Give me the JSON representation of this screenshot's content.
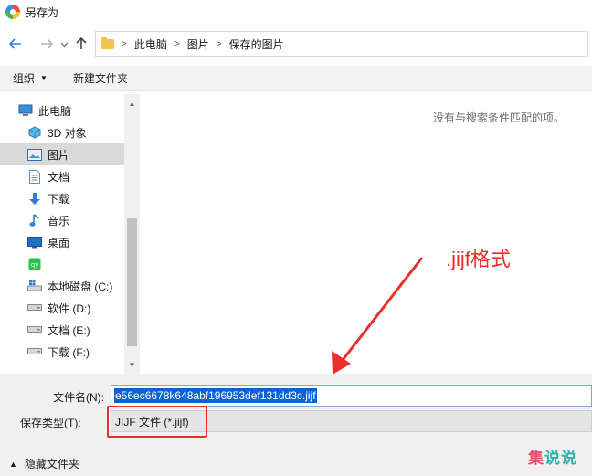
{
  "window": {
    "title": "另存为"
  },
  "nav": {
    "breadcrumbs": [
      "此电脑",
      "图片",
      "保存的图片"
    ]
  },
  "toolbar": {
    "organize_label": "组织",
    "new_folder_label": "新建文件夹"
  },
  "tree": {
    "items": [
      {
        "label": "此电脑",
        "icon": "computer-icon",
        "level": 0,
        "selected": false
      },
      {
        "label": "3D 对象",
        "icon": "3d-objects-icon",
        "level": 1,
        "selected": false
      },
      {
        "label": "图片",
        "icon": "pictures-icon",
        "level": 1,
        "selected": true
      },
      {
        "label": "文档",
        "icon": "documents-icon",
        "level": 1,
        "selected": false
      },
      {
        "label": "下载",
        "icon": "download-icon",
        "level": 1,
        "selected": false
      },
      {
        "label": "音乐",
        "icon": "music-icon",
        "level": 1,
        "selected": false
      },
      {
        "label": "桌面",
        "icon": "desktop-icon",
        "level": 1,
        "selected": false
      },
      {
        "label": "",
        "icon": "iqiyi-icon",
        "level": 1,
        "selected": false
      },
      {
        "label": "本地磁盘 (C:)",
        "icon": "windows-drive-icon",
        "level": 1,
        "selected": false
      },
      {
        "label": "软件 (D:)",
        "icon": "drive-icon",
        "level": 1,
        "selected": false
      },
      {
        "label": "文档 (E:)",
        "icon": "drive-icon",
        "level": 1,
        "selected": false
      },
      {
        "label": "下载 (F:)",
        "icon": "drive-icon",
        "level": 1,
        "selected": false
      }
    ]
  },
  "content": {
    "empty_message": "没有与搜索条件匹配的项。"
  },
  "annotation": {
    "text": ".jijf格式",
    "color": "#e8302a"
  },
  "form": {
    "filename_label": "文件名(N):",
    "filename_value": "e56ec6678k648abf196953def131dd3c.jijf",
    "filetype_label": "保存类型(T):",
    "filetype_value": "JIJF 文件 (*.jijf)"
  },
  "footer": {
    "hide_folders_label": "隐藏文件夹"
  },
  "watermark": {
    "char1": "集",
    "char2": "说",
    "char3": "说"
  },
  "colors": {
    "selection_blue": "#0a64d6",
    "folder_yellow": "#f3c64b"
  }
}
